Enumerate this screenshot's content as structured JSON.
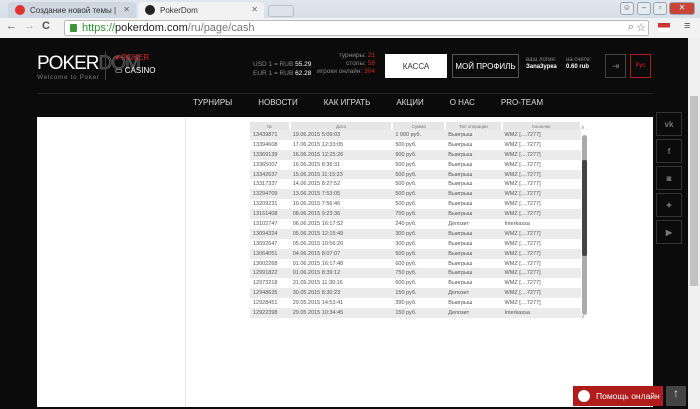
{
  "browser": {
    "tabs": [
      {
        "title": "Создание новой темы | "
      },
      {
        "title": "PokerDom"
      }
    ],
    "url_scheme": "https://",
    "url_host": "pokerdom.com",
    "url_path": "/ru/page/cash"
  },
  "header": {
    "logo_main": "POKER",
    "logo_dom": "DOM",
    "tagline": "Welcome to Poker",
    "poker": "POKER",
    "casino": "CASINO",
    "usd_label": "USD 1 = RUB",
    "usd": "55.29",
    "eur_label": "EUR 1 = RUB",
    "eur": "62.28",
    "tournaments_label": "турниры:",
    "tournaments": "21",
    "tables_label": "столы:",
    "tables": "58",
    "online_label": "игроки онлайн:",
    "online": "304",
    "kassa": "КАССА",
    "profile": "МОЙ ПРОФИЛЬ",
    "login_label": "ваш логин:",
    "login": "Заnа3урка",
    "balance_label": "на счете:",
    "balance": "0.60 rub",
    "lang": "Рус"
  },
  "menu": [
    "ТУРНИРЫ",
    "НОВОСТИ",
    "КАК ИГРАТЬ",
    "АКЦИИ",
    "О НАС",
    "PRO-TEAM"
  ],
  "table": {
    "headers": [
      "№",
      "Дата",
      "Сумма",
      "Тип операции",
      "Кошелек"
    ],
    "rows": [
      [
        "13439871",
        "19.06.2015 5:09:03",
        "1 000 руб.",
        "Выигрыш",
        "WMZ [....7277]"
      ],
      [
        "13394608",
        "17.06.2015 12:33:05",
        "500 руб.",
        "Выигрыш",
        "WMZ [....7277]"
      ],
      [
        "13369139",
        "16.06.2015 12:25:26",
        "900 руб.",
        "Выигрыш",
        "WMZ [....7277]"
      ],
      [
        "13365007",
        "16.06.2015 8:36:31",
        "500 руб.",
        "Выигрыш",
        "WMZ [....7277]"
      ],
      [
        "13342637",
        "15.06.2015 11:15:23",
        "500 руб.",
        "Выигрыш",
        "WMZ [....7277]"
      ],
      [
        "13317337",
        "14.06.2015 8:27:52",
        "500 руб.",
        "Выигрыш",
        "WMZ [....7277]"
      ],
      [
        "13294709",
        "13.06.2015 7:53:05",
        "500 руб.",
        "Выигрыш",
        "WMZ [....7277]"
      ],
      [
        "13209231",
        "10.06.2015 7:56:46",
        "500 руб.",
        "Выигрыш",
        "WMZ [....7277]"
      ],
      [
        "13161408",
        "08.06.2015 9:23:36",
        "700 руб.",
        "Выигрыш",
        "WMZ [....7277]"
      ],
      [
        "13102747",
        "06.06.2015 16:17:52",
        "240 руб.",
        "Депозит",
        "Interkassa"
      ],
      [
        "13094324",
        "05.06.2015 12:15:49",
        "300 руб.",
        "Выигрыш",
        "WMZ [....7277]"
      ],
      [
        "13092647",
        "05.06.2015 10:56:20",
        "300 руб.",
        "Выигрыш",
        "WMZ [....7277]"
      ],
      [
        "13064051",
        "04.06.2015 8:07:07",
        "500 руб.",
        "Выигрыш",
        "WMZ [....7277]"
      ],
      [
        "13002268",
        "01.06.2015 16:17:48",
        "600 руб.",
        "Выигрыш",
        "WMZ [....7277]"
      ],
      [
        "12991822",
        "01.06.2015 8:39:12",
        "750 руб.",
        "Выигрыш",
        "WMZ [....7277]"
      ],
      [
        "12973218",
        "31.05.2015 11:30:16",
        "600 руб.",
        "Выигрыш",
        "WMZ [....7277]"
      ],
      [
        "12948635",
        "30.05.2015 8:30:23",
        "150 руб.",
        "Депозит",
        "WMZ [....7277]"
      ],
      [
        "12928451",
        "29.05.2015 14:53:41",
        "390 руб.",
        "Выигрыш",
        "WMZ [....7277]"
      ],
      [
        "12922398",
        "29.05.2015 10:34:45",
        "150 руб.",
        "Депозит",
        "Interkassa"
      ]
    ]
  },
  "social": [
    "vk-icon",
    "facebook-icon",
    "instagram-icon",
    "twitter-icon",
    "youtube-icon"
  ],
  "social_glyphs": [
    "vk",
    "f",
    "◙",
    "✦",
    "▶"
  ],
  "help": "Помощь онлайн",
  "colors": {
    "accent": "#b01c1c",
    "background": "#0b0b0b"
  }
}
